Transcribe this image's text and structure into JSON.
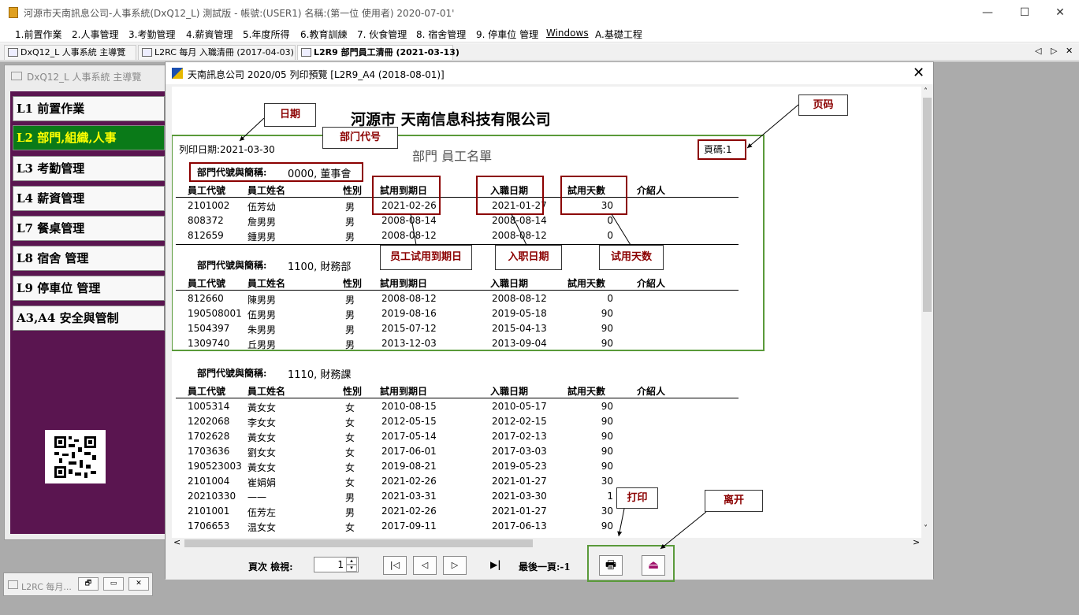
{
  "window": {
    "title": "河源市天南訊息公司-人事系統(DxQ12_L) 測試版 - 帳號:(USER1) 名稱:(第一位 使用者) 2020-07-01'",
    "controls": {
      "minimize": "—",
      "maximize": "☐",
      "close": "✕"
    }
  },
  "menu": [
    "1.前置作業",
    "2.人事管理",
    "3.考勤管理",
    "4.薪資管理",
    "5.年度所得",
    "6.教育訓練",
    "7. 伙食管理",
    "8. 宿舍管理",
    "9. 停車位 管理",
    "Windows",
    "A.基礎工程"
  ],
  "tabs": [
    "DxQ12_L 人事系統 主導覽",
    "L2RC 每月 入職清冊 (2017-04-03)",
    "L2R9 部門員工清冊 (2021-03-13)"
  ],
  "tab_scroll": {
    "left": "◁",
    "right": "▷",
    "close": "✕"
  },
  "main_window": {
    "caption": "DxQ12_L 人事系統 主導覽",
    "nav_items": [
      "L1 前置作業",
      "L2 部門,組織,人事",
      "L3 考勤管理",
      "L4 薪資管理",
      "L7 餐桌管理",
      "L8 宿舍 管理",
      "L9 停車位 管理",
      "A3,A4 安全與管制"
    ],
    "selected_nav": 1
  },
  "minimized_window": {
    "title": "L2RC 每月...",
    "buttons": [
      "🗗",
      "▭",
      "✕"
    ]
  },
  "preview": {
    "title": "天南訊息公司 2020/05 列印預覽 [L2R9_A4 (2018-08-01)]",
    "close": "✕",
    "report": {
      "company": "河源市 天南信息科技有限公司",
      "print_date": "列印日期:2021-03-30",
      "report_title": "部門 員工名單",
      "page_no": "頁碼:1",
      "columns": [
        "員工代號",
        "員工姓名",
        "性別",
        "試用到期日",
        "入職日期",
        "試用天數",
        "介紹人"
      ],
      "groups": [
        {
          "header": "部門代號與簡稱: ",
          "dept": "0000, 董事會",
          "rows": [
            [
              "2101002",
              "伍芳幼",
              "男",
              "2021-02-26",
              "2021-01-27",
              "30",
              ""
            ],
            [
              "808372",
              "詹男男",
              "男",
              "2008-08-14",
              "2008-08-14",
              "0",
              ""
            ],
            [
              "812659",
              "鍾男男",
              "男",
              "2008-08-12",
              "2008-08-12",
              "0",
              ""
            ]
          ]
        },
        {
          "header": "部門代號與簡稱: ",
          "dept": "1100, 財務部",
          "rows": [
            [
              "812660",
              "陳男男",
              "男",
              "2008-08-12",
              "2008-08-12",
              "0",
              ""
            ],
            [
              "190508001",
              "伍男男",
              "男",
              "2019-08-16",
              "2019-05-18",
              "90",
              ""
            ],
            [
              "1504397",
              "朱男男",
              "男",
              "2015-07-12",
              "2015-04-13",
              "90",
              ""
            ],
            [
              "1309740",
              "丘男男",
              "男",
              "2013-12-03",
              "2013-09-04",
              "90",
              ""
            ]
          ]
        },
        {
          "header": "部門代號與簡稱: ",
          "dept": "1110, 財務課",
          "rows": [
            [
              "1005314",
              "黃女女",
              "女",
              "2010-08-15",
              "2010-05-17",
              "90",
              ""
            ],
            [
              "1202068",
              "李女女",
              "女",
              "2012-05-15",
              "2012-02-15",
              "90",
              ""
            ],
            [
              "1702628",
              "黃女女",
              "女",
              "2017-05-14",
              "2017-02-13",
              "90",
              ""
            ],
            [
              "1703636",
              "劉女女",
              "女",
              "2017-06-01",
              "2017-03-03",
              "90",
              ""
            ],
            [
              "190523003",
              "黃女女",
              "女",
              "2019-08-21",
              "2019-05-23",
              "90",
              ""
            ],
            [
              "2101004",
              "崔娟娟",
              "女",
              "2021-02-26",
              "2021-01-27",
              "30",
              ""
            ],
            [
              "20210330",
              "一一",
              "男",
              "2021-03-31",
              "2021-03-30",
              "1",
              ""
            ],
            [
              "2101001",
              "伍芳左",
              "男",
              "2021-02-26",
              "2021-01-27",
              "30",
              ""
            ],
            [
              "1706653",
              "温女女",
              "女",
              "2017-09-11",
              "2017-06-13",
              "90",
              ""
            ]
          ]
        }
      ]
    },
    "callouts": {
      "date": "日期",
      "dept_code": "部门代号",
      "page": "页码",
      "probation_end": "员工试用到期日",
      "hire_date": "入职日期",
      "probation_days": "试用天数",
      "print": "打印",
      "exit": "离开"
    },
    "bottom": {
      "page_label": "頁次 檢視:",
      "page_value": "1",
      "last_page_label": "最後一頁:-1",
      "btn_first": "|◁",
      "btn_prev": "◁",
      "btn_next": "▷",
      "btn_last": "▶|",
      "print_icon": "🖶",
      "exit_icon": "⏏"
    },
    "scroll": {
      "up": "˄",
      "down": "˅",
      "left": "<",
      "right": ">"
    },
    "spin": {
      "up": "▴",
      "down": "▾"
    }
  }
}
